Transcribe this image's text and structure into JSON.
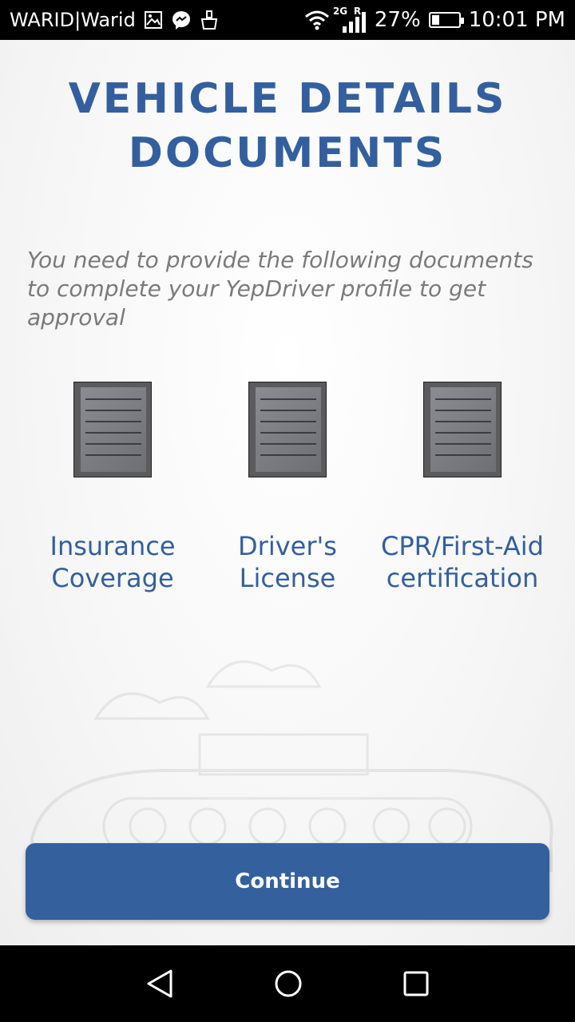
{
  "status_bar": {
    "carrier": "WARID|Warid",
    "network": "2G",
    "roaming": "R",
    "battery_percent": "27%",
    "battery_level": 0.27,
    "time": "10:01 PM",
    "icons": [
      "gallery-icon",
      "messenger-icon",
      "cleaner-icon",
      "wifi-icon",
      "signal-icon",
      "battery-icon"
    ]
  },
  "page": {
    "title_line1": "VEHICLE DETAILS",
    "title_line2": "DOCUMENTS",
    "description": "You need to provide the following documents to complete your YepDriver profile to get approval"
  },
  "documents": [
    {
      "label_line1": "Insurance",
      "label_line2": "Coverage"
    },
    {
      "label_line1": "Driver's",
      "label_line2": "License"
    },
    {
      "label_line1": "CPR/First-Aid",
      "label_line2": "certification"
    }
  ],
  "actions": {
    "continue_label": "Continue"
  },
  "colors": {
    "accent": "#335f9e",
    "button": "#34609e",
    "description": "#7a7a7a"
  },
  "nav_bar": {
    "icons": [
      "back-icon",
      "home-icon",
      "recents-icon"
    ]
  }
}
